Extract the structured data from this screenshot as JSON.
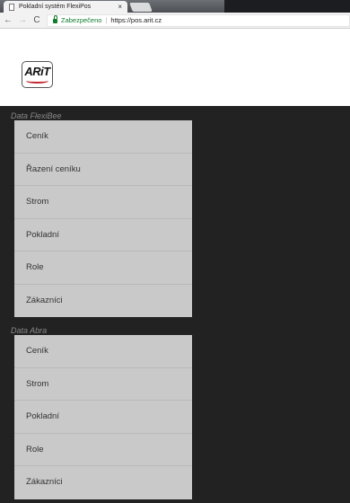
{
  "browser": {
    "tab_title": "Pokladní systém FlexiPos",
    "tab_close": "×",
    "secure_label": "Zabezpečeno",
    "url_separator": "|",
    "url": "https://pos.arit.cz",
    "back_glyph": "←",
    "forward_glyph": "→",
    "reload_glyph": "C"
  },
  "header": {
    "logo_text": "ARiT",
    "logo_accent_color": "#c0262d"
  },
  "sections": [
    {
      "label": "Data FlexiBee",
      "items": [
        "Ceník",
        "Řazení ceníku",
        "Strom",
        "Pokladní",
        "Role",
        "Zákazníci"
      ]
    },
    {
      "label": "Data Abra",
      "items": [
        "Ceník",
        "Strom",
        "Pokladní",
        "Role",
        "Zákazníci"
      ]
    }
  ],
  "colors": {
    "background": "#222222",
    "menu_background": "#c9c9c9",
    "secure_green": "#137c2f"
  }
}
